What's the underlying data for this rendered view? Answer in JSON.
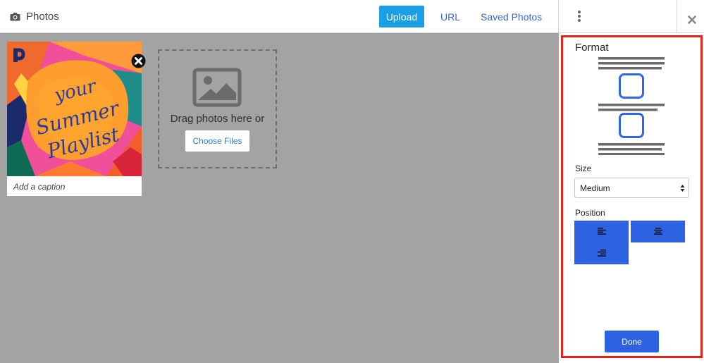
{
  "header": {
    "title": "Photos",
    "title_icon": "camera-icon",
    "tabs": [
      {
        "label": "Upload",
        "active": true
      },
      {
        "label": "URL",
        "active": false
      },
      {
        "label": "Saved Photos",
        "active": false
      }
    ],
    "menu_icon": "more-vertical-icon",
    "close_icon": "close-icon"
  },
  "photos": {
    "items": [
      {
        "artwork_text": [
          "your",
          "Summer",
          "Playlist"
        ],
        "caption_placeholder": "Add a caption",
        "remove_icon": "remove-circle-icon"
      }
    ]
  },
  "dropzone": {
    "icon": "image-icon",
    "text": "Drag photos here or",
    "button_label": "Choose Files"
  },
  "format_panel": {
    "title": "Format",
    "size_label": "Size",
    "size_value": "Medium",
    "position_label": "Position",
    "position_options": [
      {
        "icon": "align-left-icon"
      },
      {
        "icon": "align-center-icon"
      },
      {
        "icon": "align-right-icon"
      }
    ],
    "done_label": "Done"
  },
  "colors": {
    "primary_button": "#2d63e3",
    "upload_tab": "#1a9ee6",
    "link": "#3a67d6",
    "canvas_gray": "#a3a3a3",
    "highlight_outline": "#e8251c"
  }
}
